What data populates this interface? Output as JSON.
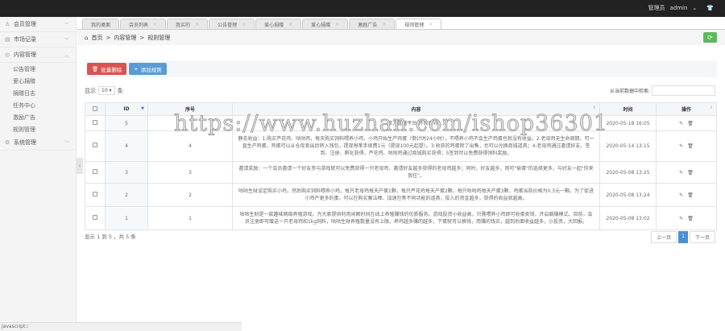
{
  "header": {
    "role": "管理员",
    "user": "admin"
  },
  "sidebar": {
    "items": [
      {
        "label": "会员管理"
      },
      {
        "label": "市场记录"
      },
      {
        "label": "内容管理"
      },
      {
        "label": "系统管理"
      }
    ],
    "sub": [
      "公告管理",
      "爱心捐赠",
      "捐赠日志",
      "任务中心",
      "激励广告",
      "规则管理"
    ]
  },
  "tabs": [
    "我的桌面",
    "会员列表",
    "我买的",
    "公告管理",
    "爱心捐赠",
    "爱心捐赠",
    "激励广告",
    "规则管理"
  ],
  "breadcrumb": [
    "首页",
    "内容管理",
    "规则管理"
  ],
  "toolbar": {
    "batch_delete": "批量删除",
    "add_rule": "添加规则"
  },
  "length": {
    "prefix": "显示",
    "value": "10",
    "suffix": "条"
  },
  "search": {
    "label": "从当前数据中检索:"
  },
  "table": {
    "headers": [
      "ID",
      "序号",
      "内容",
      "时间",
      "操作"
    ],
    "rows": [
      {
        "id": "5",
        "seq": "",
        "content": "官方直播平台(开放时间...)",
        "time": "2020-05-18 16:05"
      },
      {
        "id": "4",
        "seq": "4",
        "content": "静态收益：1.购买芦花鸡、咕咕鸡，每天购买饲料喂养小鸡，小鸡开始生产鸡蛋（倒计时24小时），不喂养小鸡不会生产鸡蛋也就没有收益。2.老母鸡无生命周期，可一直生产鸡蛋，鸡蛋可以从仓库卖出后转入钱包，提现每笔手续费1元（提现100元起提）。3.收获的鸡蛋除了出售，也可以兑换商城道具；4.老母鸡通过邀请好友、签到、注册、孵化获得，芦花鸡、咕咕鸡通过商城购买获得；5签到可以免费获得饲料奖励。",
        "time": "2020-05-14 13:15"
      },
      {
        "id": "3",
        "seq": "3",
        "content": "邀请奖励：一个会员邀请一个好友参与游戏就可以免费获得一只老母鸡，邀请好友越多获得的老母鸡越多；同时，好友越多，则可\"偷蛋\"的选择更多，与好友一起\"你来我往\"。",
        "time": "2020-05-08 13:25"
      },
      {
        "id": "2",
        "seq": "2",
        "content": "咕咕生财设定购买小鸡，然后购买饲料喂养小鸡，每只老母鸡每天产蛋1颗，每只芦花鸡每天产蛋2颗，每只咕咕鸡每天产蛋3颗，鸡蛋当前价格为0.3元一颗。为了促进小鸡产更多的蛋，可以在购买魔法棒、加速包等不同功能的道具，投入的资金越多，获得的收益就越高。",
        "time": "2020-05-08 13:24"
      },
      {
        "id": "1",
        "seq": "1",
        "content": "咕咕生财是一款趣味网络养殖游戏，为大家提供利用闲暇时间在线上养殖赚钱的优质服务。游戏投资小收益高，只需喂养小鸡即可收蛋卖钱，开启躺赚模式。目前，会员注册即可赠送一只老母鸡和1kg饲料，咕咕生财养殖数量没有上限，养鸡越多赚的越多，下蛋就可以换钱，用赚的钱买，越到后面收益越多，小投资，大回报。",
        "time": "2020-05-08 13:02"
      }
    ]
  },
  "footer": {
    "info": "显示 1 到 5 ，共 5 条",
    "prev": "上一页",
    "page": "1",
    "next": "下一页"
  },
  "status": "javascript:;",
  "watermark": "https://www.huzhan.com/ishop36301"
}
